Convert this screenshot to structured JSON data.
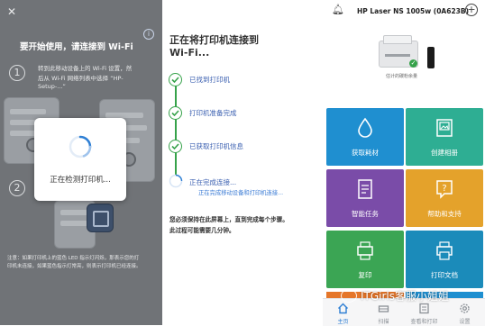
{
  "left_panel": {
    "title": "要开始使用，请连接到 Wi-Fi",
    "step1_number": "1",
    "step1_text_line1": "转到此移动设备上的 Wi-Fi 设置，然",
    "step1_text_line2": "后从 Wi-Fi 网络列表中选择 “HP-",
    "step1_text_line3": "Setup-...”",
    "step2_number": "2",
    "footer_line1": "注意：如果打印机上的蓝色 LED 指示灯闪烁，那表示您的打",
    "footer_line2": "印机未连接，如果蓝色指示灯常亮，则表示打印机已经连接。"
  },
  "modal": {
    "message": "正在检测打印机..."
  },
  "middle_panel": {
    "title_line1": "正在将打印机连接到",
    "title_line2": "Wi-Fi...",
    "steps": [
      {
        "label": "已找到打印机"
      },
      {
        "label": "打印机准备完成"
      },
      {
        "label": "已获取打印机信息"
      },
      {
        "label": "正在完成连接...",
        "sublabel": "正在完成移动设备和打印机连接..."
      }
    ],
    "note_line1": "您必须保持在此屏幕上，直到完成每个步骤。",
    "note_line2": "此过程可能需要几分钟。"
  },
  "right_panel": {
    "printer_name": "HP Laser NS 1005w (0A623B)",
    "printer_status": "估计的碳粉余量",
    "tiles": [
      {
        "label": "获取耗材",
        "color": "#1f8fd0",
        "icon": "drop-icon"
      },
      {
        "label": "创建相册",
        "color": "#2eae93",
        "icon": "photo-album-icon"
      },
      {
        "label": "智能任务",
        "color": "#7a4ca8",
        "icon": "smart-task-icon"
      },
      {
        "label": "帮助和支持",
        "color": "#e4a22b",
        "icon": "help-icon"
      },
      {
        "label": "复印",
        "color": "#3ba554",
        "icon": "copy-icon"
      },
      {
        "label": "打印文档",
        "color": "#1b8bba",
        "icon": "print-document-icon"
      }
    ],
    "nav": [
      {
        "label": "主页",
        "icon": "home-icon"
      },
      {
        "label": "扫描",
        "icon": "scan-icon"
      },
      {
        "label": "查看和打印",
        "icon": "view-print-icon"
      },
      {
        "label": "设置",
        "icon": "settings-icon"
      }
    ],
    "watermark": "ITGirls客服小姐姐"
  },
  "colors": {
    "accent_blue": "#3a5fb0",
    "success_green": "#36a24a",
    "dim_overlay": "#707377"
  }
}
